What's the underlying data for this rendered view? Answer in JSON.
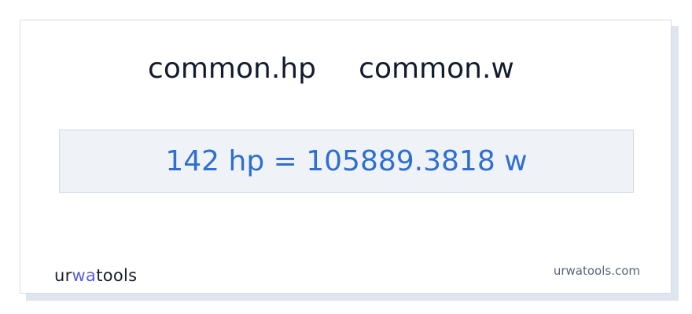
{
  "conversion": {
    "from_unit": "common.hp",
    "to_unit": "common.w",
    "result": "142 hp = 105889.3818 w"
  },
  "brand": {
    "logo_text_part1": "ur",
    "logo_text_part2": "wa",
    "logo_text_part3": "tools",
    "domain": "urwatools.com"
  },
  "colors": {
    "result_text": "#2d6fd2",
    "logo_accent": "#5a5dd8",
    "result_box_bg": "#eff3f8"
  }
}
